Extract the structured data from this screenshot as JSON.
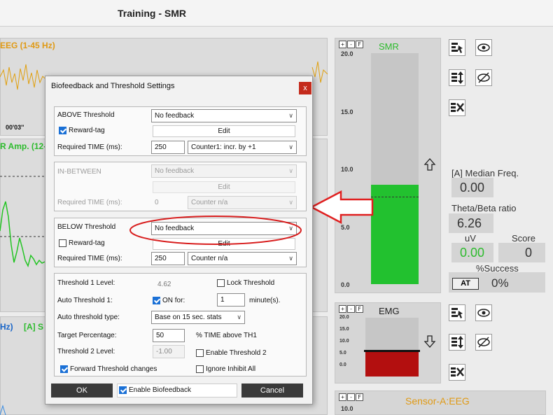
{
  "window": {
    "title": "Training - SMR"
  },
  "left_panels": {
    "eeg_label": "EEG (1-45 Hz)",
    "time_label": "00'03''",
    "amp_label": "R Amp. (12-",
    "bottom_label_a": "Hz)",
    "bottom_label_b": "[A] S"
  },
  "meters": {
    "smr": {
      "title": "SMR",
      "ticks": [
        "20.0",
        "15.0",
        "10.0",
        "5.0",
        "0.0"
      ],
      "level": 0.43,
      "threshold": 0.38,
      "color": "#22c12f"
    },
    "emg": {
      "title": "EMG",
      "ticks": [
        "20.0",
        "15.0",
        "10.0",
        "5.0",
        "0.0"
      ],
      "level": 0.44,
      "color": "#b30f0f"
    },
    "sensor": {
      "title": "Sensor-A:EEG",
      "tick_top": "10.0"
    },
    "button_labels": [
      "+",
      "-",
      "F"
    ]
  },
  "stats": {
    "median_freq_label": "[A] Median Freq.",
    "median_freq_value": "0.00",
    "theta_beta_label": "Theta/Beta ratio",
    "theta_beta_value": "6.26",
    "uv_label": "uV",
    "uv_value": "0.00",
    "score_label": "Score",
    "score_value": "0",
    "success_label": "%Success",
    "at_button": "AT",
    "success_value": "0%"
  },
  "dialog": {
    "title": "Biofeedback and Threshold Settings",
    "close": "x",
    "above": {
      "label": "ABOVE Threshold",
      "feedback": "No feedback",
      "reward_tag": "Reward-tag",
      "reward_checked": true,
      "edit": "Edit",
      "time_label": "Required TIME (ms):",
      "time_value": "250",
      "counter": "Counter1: incr. by +1"
    },
    "between": {
      "label": "IN-BETWEEN",
      "feedback": "No feedback",
      "edit": "Edit",
      "time_label": "Required TIME (ms):",
      "time_value": "0",
      "counter": "Counter n/a"
    },
    "below": {
      "label": "BELOW Threshold",
      "feedback": "No feedback",
      "reward_tag": "Reward-tag",
      "reward_checked": false,
      "edit": "Edit",
      "time_label": "Required TIME (ms):",
      "time_value": "250",
      "counter": "Counter n/a"
    },
    "threshold": {
      "t1_label": "Threshold 1 Level:",
      "t1_value": "4.62",
      "lock_label": "Lock Threshold",
      "auto_label": "Auto Threshold 1:",
      "on_label": "ON for:",
      "on_value": "1",
      "minutes_label": "minute(s).",
      "type_label": "Auto threshold type:",
      "type_value": "Base on 15 sec. stats",
      "target_label": "Target Percentage:",
      "target_value": "50",
      "target_suffix": "% TIME above TH1",
      "t2_label": "Threshold 2 Level:",
      "t2_value": "-1.00",
      "enable_t2_label": "Enable Threshold 2",
      "forward_label": "Forward Threshold changes",
      "ignore_label": "Ignore Inhibit All"
    },
    "ok": "OK",
    "enable_biofeedback": "Enable Biofeedback",
    "cancel": "Cancel"
  }
}
